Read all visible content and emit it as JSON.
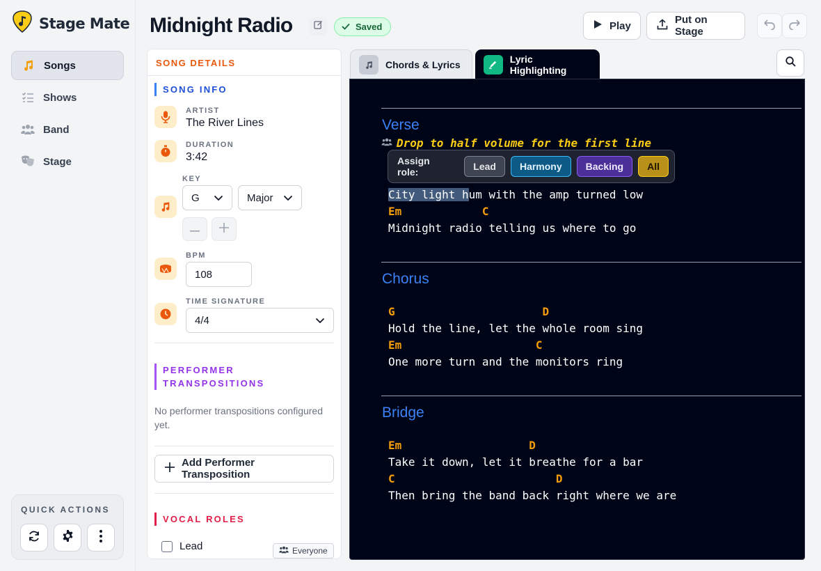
{
  "app": {
    "name": "Stage Mate"
  },
  "sidebar": {
    "items": [
      {
        "label": "Songs",
        "icon": "music-note-icon",
        "active": true
      },
      {
        "label": "Shows",
        "icon": "list-check-icon",
        "active": false
      },
      {
        "label": "Band",
        "icon": "users-icon",
        "active": false
      },
      {
        "label": "Stage",
        "icon": "masks-icon",
        "active": false
      }
    ],
    "quick_actions": {
      "title": "QUICK ACTIONS",
      "icons": [
        "refresh-icon",
        "gear-icon",
        "more-vertical-icon"
      ]
    }
  },
  "header": {
    "title": "Midnight Radio",
    "status": "Saved",
    "play_label": "Play",
    "stage_label": "Put on Stage"
  },
  "details": {
    "panel_title": "SONG DETAILS",
    "song_info_title": "SONG INFO",
    "artist_label": "ARTIST",
    "artist": "The River Lines",
    "duration_label": "DURATION",
    "duration": "3:42",
    "key_label": "KEY",
    "key": "G",
    "mode": "Major",
    "bpm_label": "BPM",
    "bpm": "108",
    "time_sig_label": "TIME SIGNATURE",
    "time_sig": "4/4",
    "transpositions_title_1": "PERFORMER",
    "transpositions_title_2": "TRANSPOSITIONS",
    "transpositions_empty": "No performer transpositions configured yet.",
    "add_transposition": "Add Performer Transposition",
    "vocal_roles_title": "VOCAL ROLES",
    "role_lead": "Lead",
    "everyone": "Everyone"
  },
  "tabs": [
    {
      "label": "Chords & Lyrics",
      "active": false
    },
    {
      "label": "Lyric Highlighting",
      "active": true
    }
  ],
  "editor": {
    "verse": {
      "name": "Verse",
      "note": "Drop to half volume for the first line",
      "line1_highlighted": "City light h",
      "line1_rest": "um with the amp turned low",
      "chords2": "Em            C",
      "line2": "Midnight radio telling us where to go"
    },
    "chorus": {
      "name": "Chorus",
      "chords1": "G                      D",
      "line1": "Hold the line, let the whole room sing",
      "chords2": "Em                    C",
      "line2": "One more turn and the monitors ring"
    },
    "bridge": {
      "name": "Bridge",
      "chords1": "Em                   D",
      "line1": "Take it down, let it breathe for a bar",
      "chords2": "C                        D",
      "line2": "Then bring the band back right where we are"
    }
  },
  "role_popup": {
    "label": "Assign role:",
    "lead": "Lead",
    "harmony": "Harmony",
    "backing": "Backing",
    "all": "All"
  },
  "colors": {
    "accent_orange": "#ea580c",
    "chord": "#f59e0b",
    "section": "#3b82f6",
    "editor_bg": "#000417",
    "saved_green": "#166534"
  }
}
